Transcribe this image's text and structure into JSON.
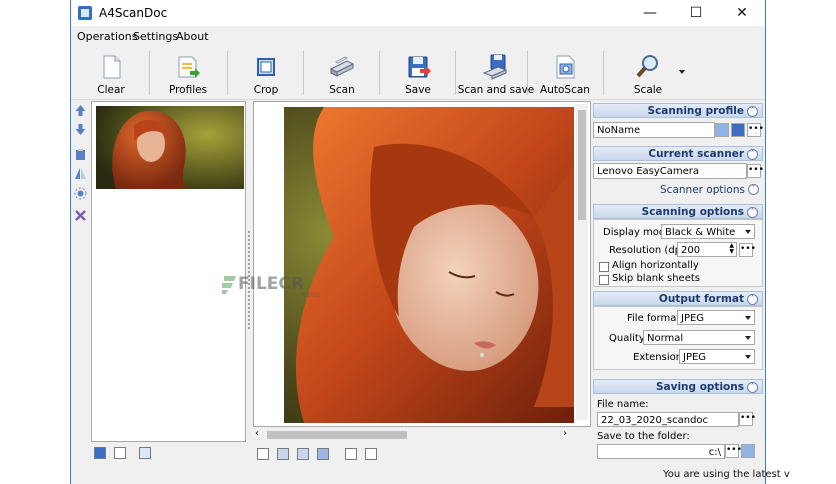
{
  "window": {
    "title": "A4ScanDoc"
  },
  "menu": {
    "items": [
      "Operations",
      "Settings",
      "About"
    ]
  },
  "toolbar": {
    "buttons": [
      {
        "label": "Clear",
        "icon": "blank-page-icon"
      },
      {
        "label": "Profiles",
        "icon": "profiles-icon"
      },
      {
        "label": "Crop",
        "icon": "crop-icon"
      },
      {
        "label": "Scan",
        "icon": "scanner-icon"
      },
      {
        "label": "Save",
        "icon": "floppy-disk-icon"
      },
      {
        "label": "Scan and save",
        "icon": "scan-save-icon"
      },
      {
        "label": "AutoScan",
        "icon": "autoscan-icon"
      },
      {
        "label": "Scale",
        "icon": "magnifier-icon"
      }
    ]
  },
  "watermark": {
    "text": "FILECR",
    "suffix": ".com"
  },
  "right_panel": {
    "scanning_profile": {
      "title": "Scanning profile",
      "value": "NoName"
    },
    "current_scanner": {
      "title": "Current scanner",
      "value": "Lenovo EasyCamera",
      "options_label": "Scanner options"
    },
    "scanning_options": {
      "title": "Scanning options",
      "display_mode_label": "Display mode:",
      "display_mode_value": "Black & White",
      "resolution_label": "Resolution (dpi):",
      "resolution_value": "200",
      "align_label": "Align horizontally",
      "skip_label": "Skip blank sheets"
    },
    "output_format": {
      "title": "Output format",
      "file_format_label": "File format:",
      "file_format_value": "JPEG",
      "quality_label": "Quality:",
      "quality_value": "Normal",
      "extension_label": "Extension:",
      "extension_value": "JPEG"
    },
    "saving_options": {
      "title": "Saving options",
      "file_name_label": "File name:",
      "file_name_value": "22_03_2020_scandoc",
      "folder_label": "Save to the folder:",
      "folder_value": "c:\\"
    }
  },
  "status": {
    "text": "You are using the latest v"
  },
  "colors": {
    "accent": "#1e3a6e",
    "window_border": "#3a7bd5",
    "hair": "#c4501e"
  }
}
